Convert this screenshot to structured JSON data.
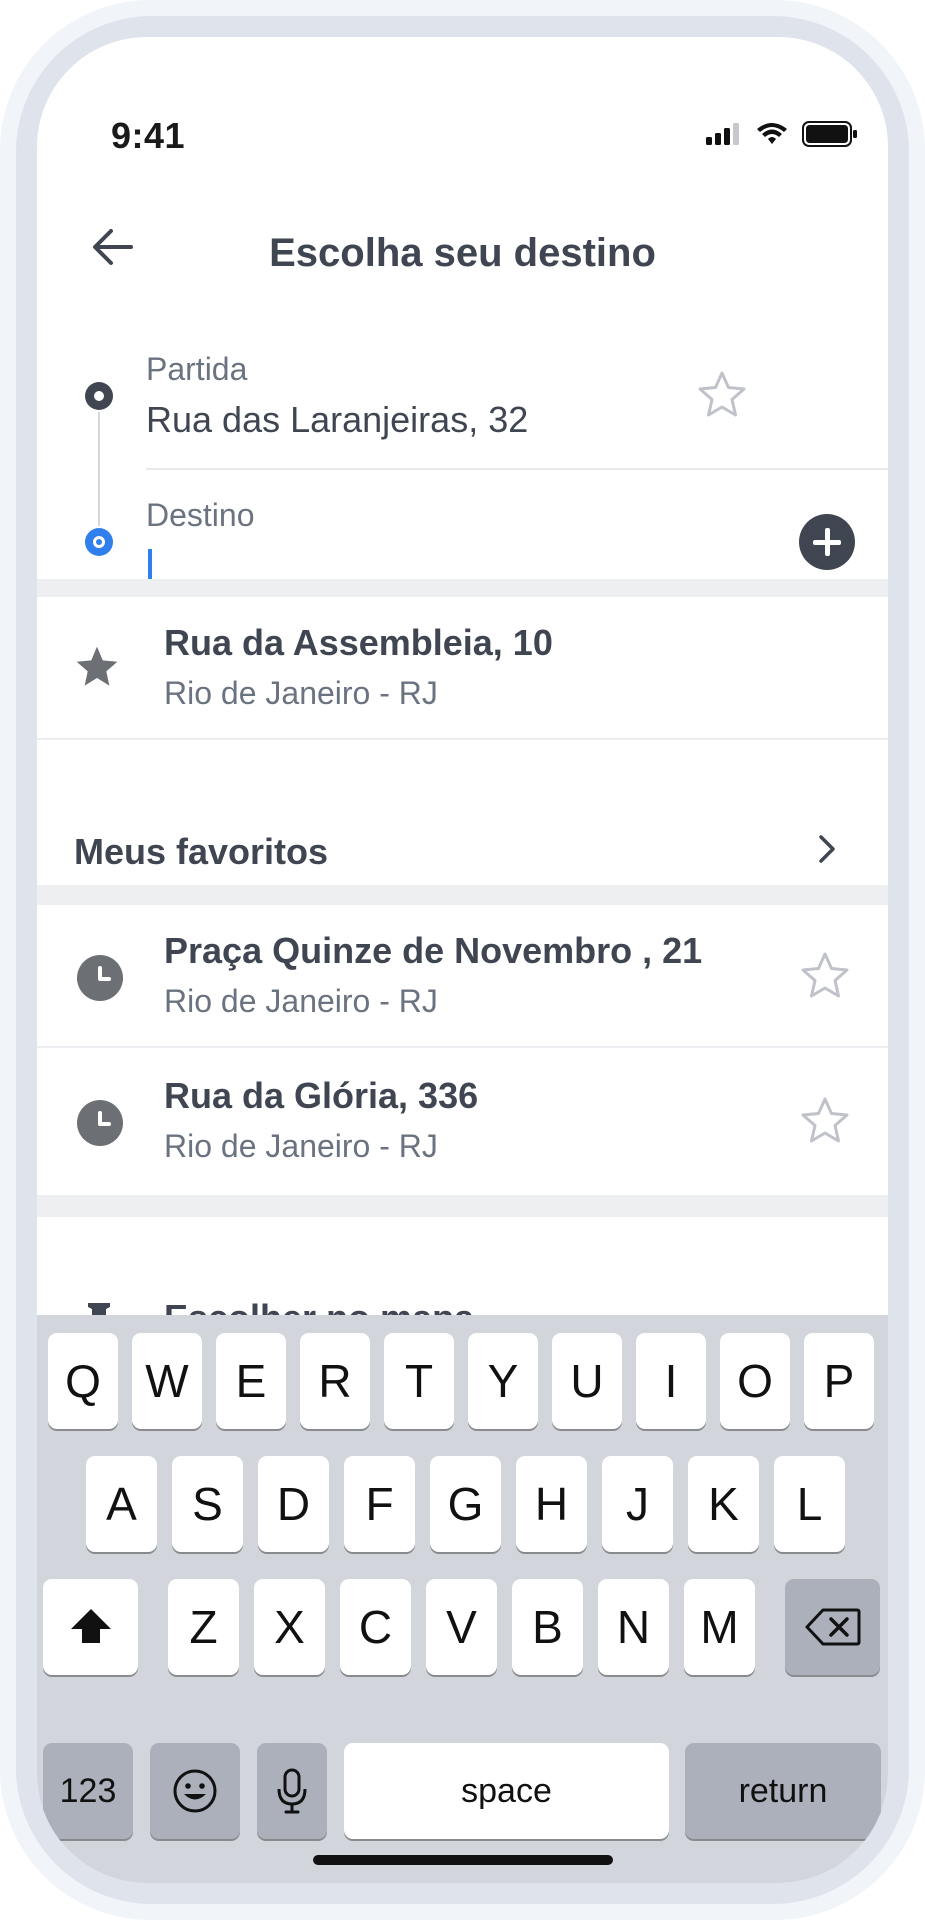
{
  "status": {
    "time": "9:41"
  },
  "header": {
    "title": "Escolha seu destino"
  },
  "route": {
    "origin_label": "Partida",
    "origin_value": "Rua das Laranjeiras, 32",
    "destination_label": "Destino",
    "destination_value": ""
  },
  "favorite_suggestion": {
    "title": "Rua da Assembleia, 10",
    "subtitle": "Rio de Janeiro - RJ"
  },
  "favorites_link": {
    "label": "Meus favoritos"
  },
  "recent": [
    {
      "title": "Praça Quinze de Novembro , 21",
      "subtitle": "Rio de Janeiro - RJ"
    },
    {
      "title": "Rua da Glória, 336",
      "subtitle": "Rio de Janeiro - RJ"
    }
  ],
  "map_option": {
    "label": "Escolher no mapa"
  },
  "keyboard": {
    "row1": [
      "Q",
      "W",
      "E",
      "R",
      "T",
      "Y",
      "U",
      "I",
      "O",
      "P"
    ],
    "row2": [
      "A",
      "S",
      "D",
      "F",
      "G",
      "H",
      "J",
      "K",
      "L"
    ],
    "row3": [
      "Z",
      "X",
      "C",
      "V",
      "B",
      "N",
      "M"
    ],
    "numbers_key": "123",
    "space_key": "space",
    "return_key": "return"
  },
  "colors": {
    "accent": "#2f80ed",
    "text": "#3f4651",
    "muted": "#6b7380"
  }
}
